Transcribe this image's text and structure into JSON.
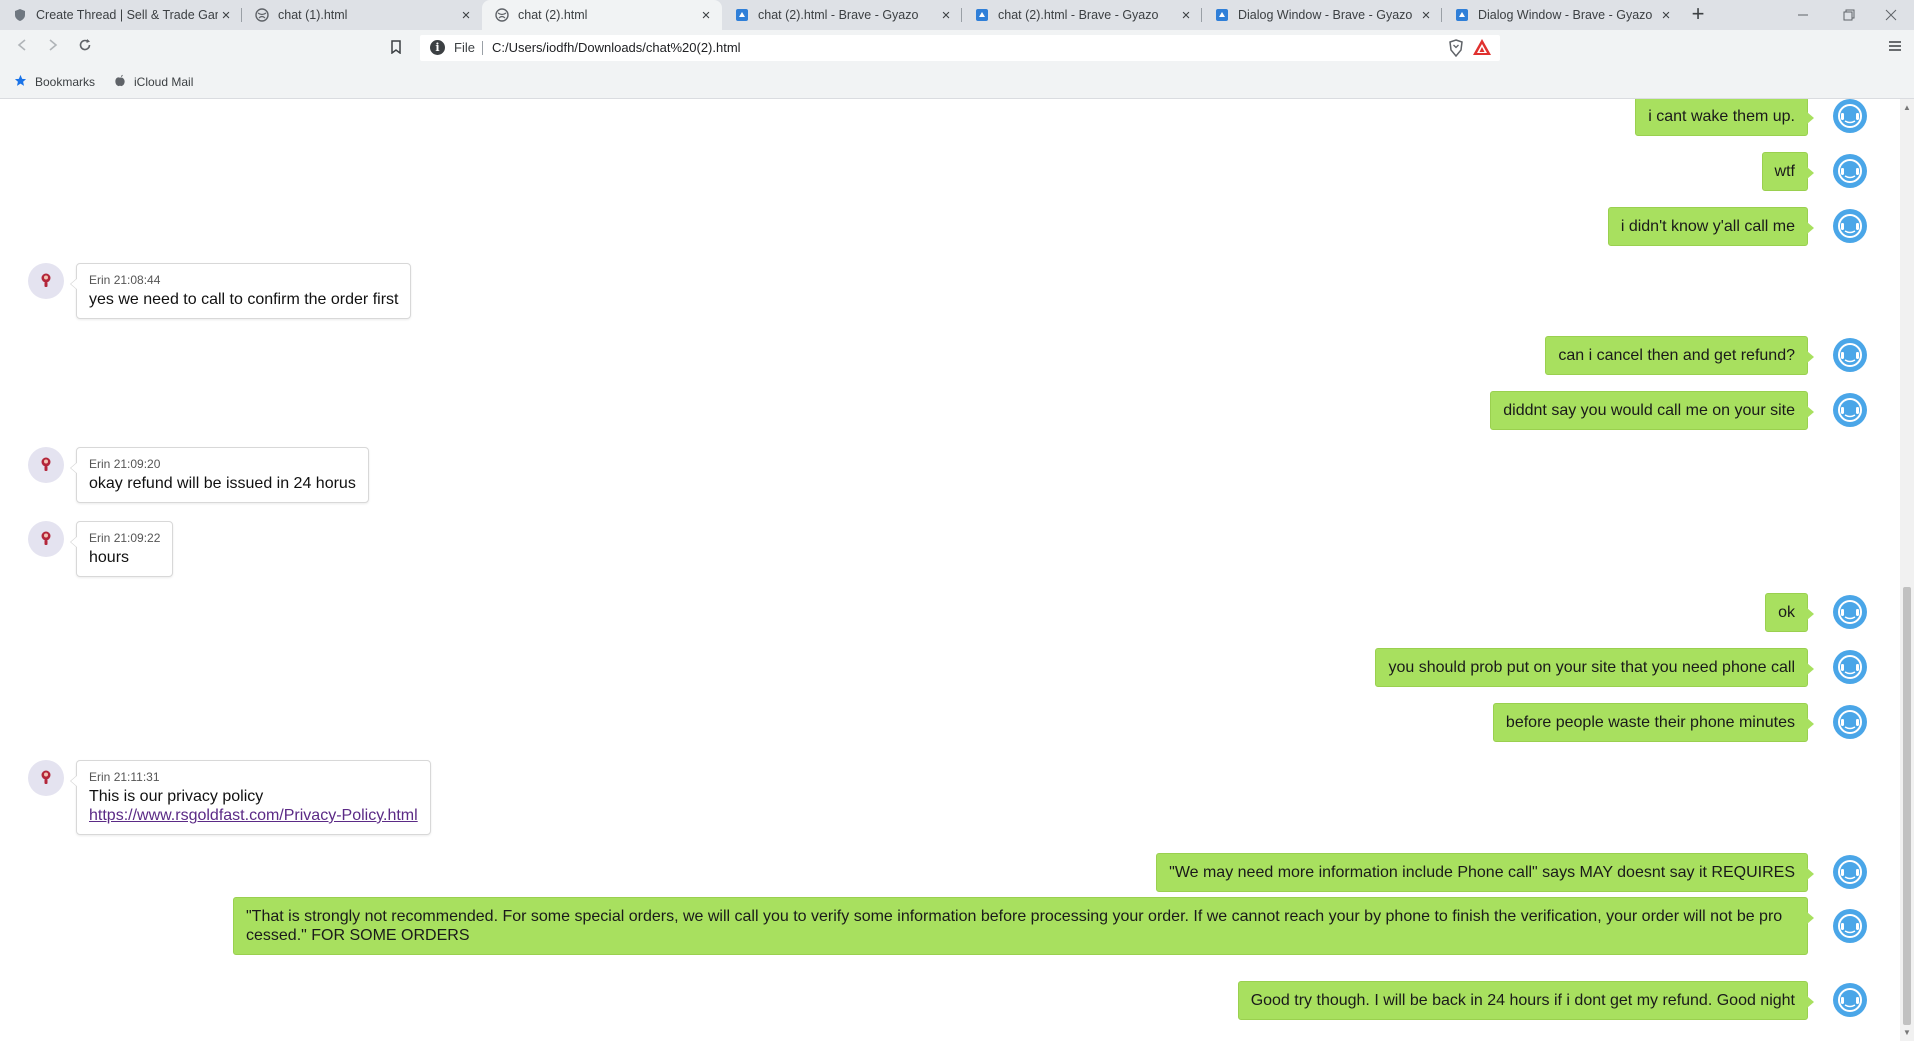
{
  "browser": {
    "tabs": [
      {
        "title": "Create Thread | Sell & Trade Game",
        "icon": "shield-icon"
      },
      {
        "title": "chat (1).html",
        "icon": "globe-icon"
      },
      {
        "title": "chat (2).html",
        "icon": "globe-icon",
        "active": true
      },
      {
        "title": "chat (2).html - Brave - Gyazo",
        "icon": "gyazo-icon"
      },
      {
        "title": "chat (2).html - Brave - Gyazo",
        "icon": "gyazo-icon"
      },
      {
        "title": "Dialog Window - Brave - Gyazo",
        "icon": "gyazo-icon"
      },
      {
        "title": "Dialog Window - Brave - Gyazo",
        "icon": "gyazo-icon"
      }
    ],
    "close_glyph": "×",
    "new_tab_glyph": "+",
    "address": {
      "scheme": "File",
      "url": "C:/Users/iodfh/Downloads/chat%20(2).html"
    },
    "bookmarks": [
      {
        "label": "Bookmarks",
        "icon": "star-icon"
      },
      {
        "label": "iCloud Mail",
        "icon": "apple-icon"
      }
    ]
  },
  "chat": {
    "messages": [
      {
        "from": "me",
        "text": "i cant wake them up."
      },
      {
        "from": "me",
        "text": "wtf"
      },
      {
        "from": "me",
        "text": "i didn't know y'all call me"
      },
      {
        "from": "agent",
        "name": "Erin",
        "time": "21:08:44",
        "text": "yes we need to call  to confirm the order first"
      },
      {
        "from": "me",
        "text": "can i cancel then and get refund?"
      },
      {
        "from": "me",
        "text": "diddnt say you would call me on your site"
      },
      {
        "from": "agent",
        "name": "Erin",
        "time": "21:09:20",
        "text": "okay refund will be issued in 24 horus"
      },
      {
        "from": "agent",
        "name": "Erin",
        "time": "21:09:22",
        "text": "hours"
      },
      {
        "from": "me",
        "text": "ok"
      },
      {
        "from": "me",
        "text": "you should prob put on your site that you need phone call"
      },
      {
        "from": "me",
        "text": "before people waste their phone minutes"
      },
      {
        "from": "agent",
        "name": "Erin",
        "time": "21:11:31",
        "text": "This is our privacy policy",
        "link": "https://www.rsgoldfast.com/Privacy-Policy.html"
      },
      {
        "from": "me",
        "text": "\"We may need more information include Phone call\"  says MAY doesnt say it REQUIRES"
      },
      {
        "from": "me",
        "text": "\"That is strongly not recommended. For some special orders, we will call you to verify some information before processing your order. If we cannot reach your by phone to finish the verification, your order will not be pro cessed.\" FOR SOME ORDERS"
      },
      {
        "from": "me",
        "text": "Good try though. I will be back in 24 hours if i dont get my refund. Good night"
      }
    ]
  },
  "colors": {
    "outgoing_bubble": "#a8e05f",
    "agent_avatar": "#4aa6e8",
    "link": "#5b2a86"
  }
}
